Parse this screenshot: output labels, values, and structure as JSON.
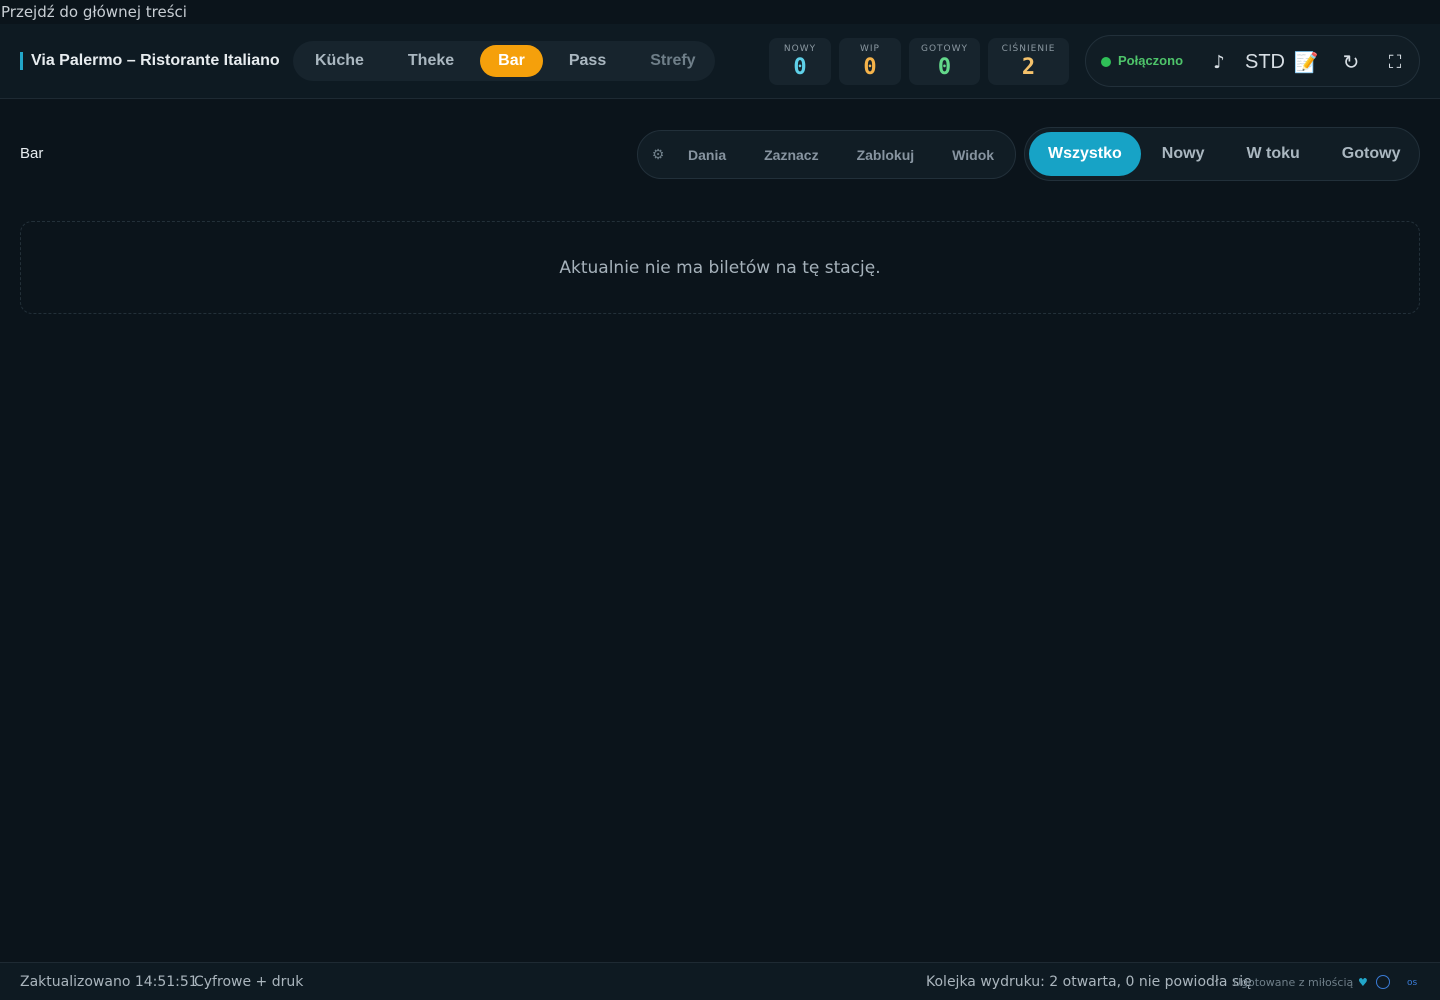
{
  "skip_link": "Przejdź do głównej treści",
  "header": {
    "brand": "Via Palermo – Ristorante Italiano",
    "tabs": [
      {
        "label": "Küche"
      },
      {
        "label": "Theke"
      },
      {
        "label": "Bar"
      },
      {
        "label": "Pass"
      },
      {
        "label": "Strefy"
      }
    ],
    "active_tab": "Bar",
    "stats": [
      {
        "label": "NOWY",
        "value": "0",
        "color": "#5fd0e8"
      },
      {
        "label": "WIP",
        "value": "0",
        "color": "#f5b34a"
      },
      {
        "label": "GOTOWY",
        "value": "0",
        "color": "#63d88a"
      },
      {
        "label": "CIŚNIENIE",
        "value": "2",
        "color": "#f5c26b"
      }
    ],
    "connection": {
      "label": "Połączono",
      "color": "#2fbf57"
    },
    "sound_icon": "♪",
    "mode_label": "STD",
    "notes_icon": "📝",
    "refresh_icon": "↻",
    "fullscreen_icon": "⛶"
  },
  "main": {
    "title": "Bar",
    "tools": {
      "gear_icon": "⚙",
      "items": [
        {
          "label": "Dania"
        },
        {
          "label": "Zaznacz"
        },
        {
          "label": "Zablokuj"
        },
        {
          "label": "Widok"
        }
      ]
    },
    "filters": [
      {
        "label": "Wszystko"
      },
      {
        "label": "Nowy"
      },
      {
        "label": "W toku"
      },
      {
        "label": "Gotowy"
      }
    ],
    "active_filter": "Wszystko",
    "empty_message": "Aktualnie nie ma biletów na tę stację."
  },
  "footer": {
    "updated": "Zaktualizowano 14:51:51",
    "mode": "Cyfrowe + druk",
    "print_queue": "Kolejka wydruku: 2 otwarta, 0 nie powiodła się",
    "credit": "Ugotowane z miłością",
    "heart": "♥",
    "os_label": "os"
  },
  "colors": {
    "accent_orange": "#f5a00b",
    "accent_cyan": "#17a3c6",
    "background": "#0b141b"
  }
}
